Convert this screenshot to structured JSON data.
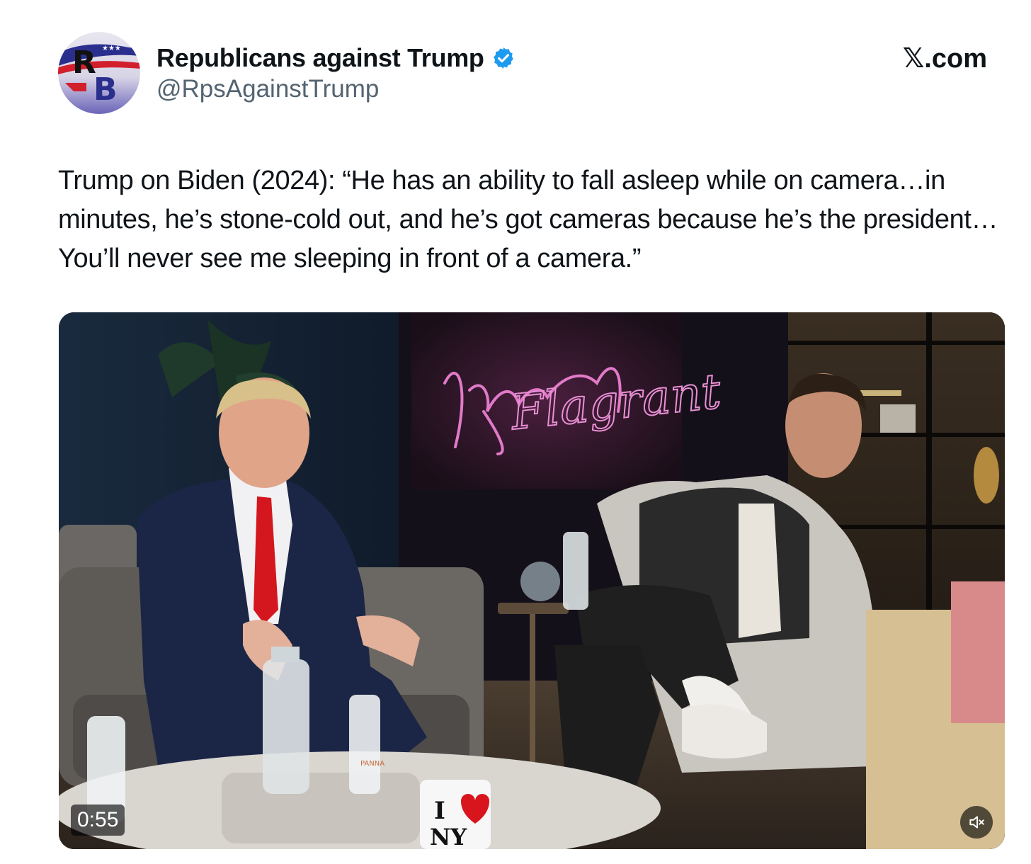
{
  "author": {
    "display_name": "Republicans against Trump",
    "handle": "@RpsAgainstTrump",
    "verified": true,
    "avatar_letters": "RB"
  },
  "source_site": "𝕏.com",
  "tweet": {
    "text": "Trump on Biden (2024): “He has an ability to fall asleep while on camera…in minutes, he’s stone-cold out, and he’s got cameras because he’s the president…You’ll never see me sleeping in front of a camera.”"
  },
  "video": {
    "duration": "0:55",
    "muted": true,
    "neon_sign": "Flagrant",
    "mug_text_top": "I",
    "mug_text_bottom": "NY",
    "bottle_label": "PANNA"
  },
  "colors": {
    "verified_blue": "#1d9bf0",
    "handle_gray": "#536471",
    "text_dark": "#0f1419",
    "neon_pink": "#e07ac8"
  }
}
